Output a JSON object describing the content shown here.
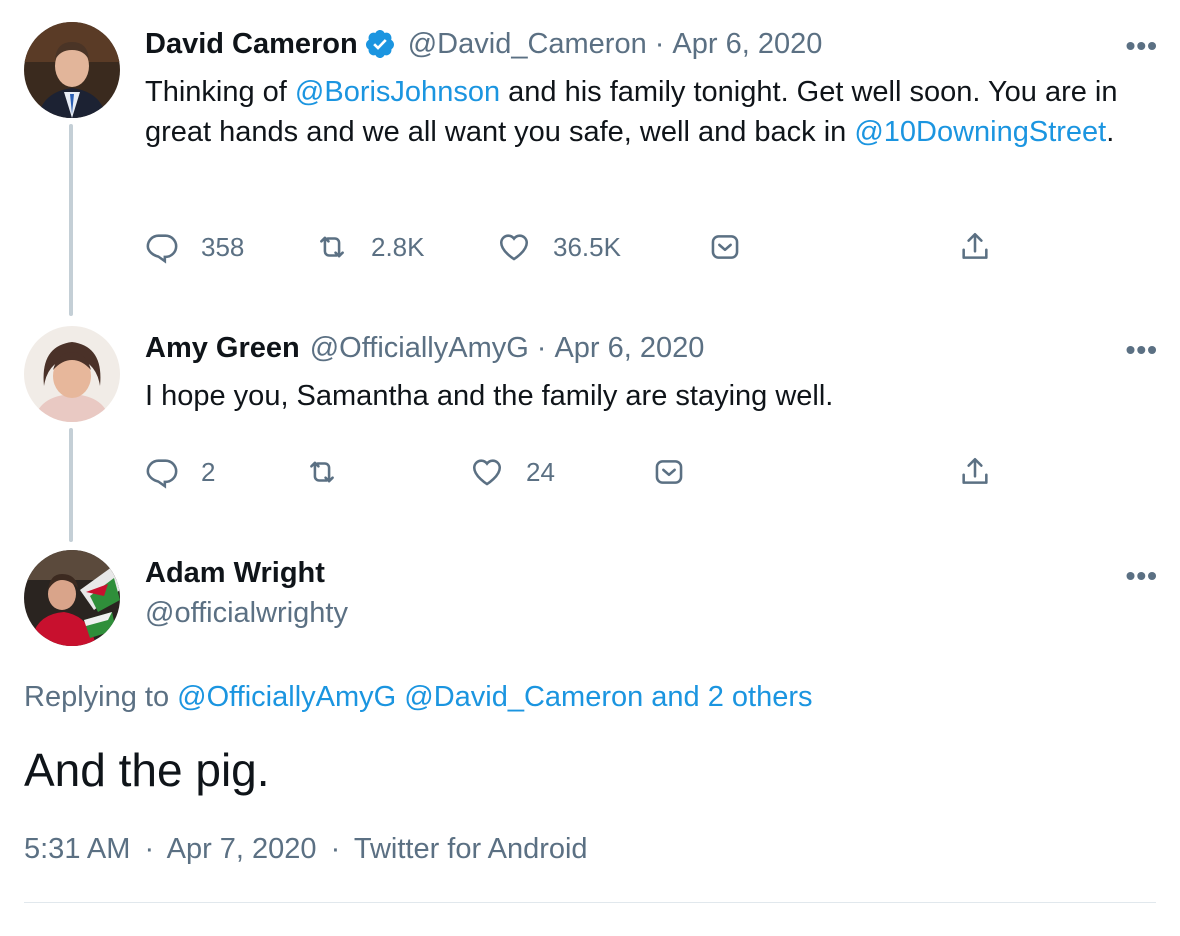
{
  "tweets": [
    {
      "name": "David Cameron",
      "verified": true,
      "handle": "@David_Cameron",
      "date": "Apr 6, 2020",
      "text_parts": [
        {
          "t": "Thinking of ",
          "link": false
        },
        {
          "t": "@BorisJohnson",
          "link": true
        },
        {
          "t": " and his family tonight. Get well soon. You are in great hands and we all want you safe, well and back in ",
          "link": false
        },
        {
          "t": "@10DowningStreet",
          "link": true
        },
        {
          "t": ".",
          "link": false
        }
      ],
      "replies": "358",
      "retweets": "2.8K",
      "likes": "36.5K",
      "icons": [
        "reply-icon",
        "retweet-icon",
        "like-icon",
        "caret-icon",
        "share-icon"
      ]
    },
    {
      "name": "Amy Green",
      "handle": "@OfficiallyAmyG",
      "date": "Apr 6, 2020",
      "text": "I hope you, Samantha and the family are staying well.",
      "replies": "2",
      "retweets": "",
      "likes": "24"
    }
  ],
  "main": {
    "name": "Adam Wright",
    "handle": "@officialwrighty",
    "replying_prefix": "Replying to",
    "replying_to": "@OfficiallyAmyG @David_Cameron and 2 others",
    "text": "And the pig.",
    "time": "5:31 AM",
    "date": "Apr 7, 2020",
    "source": "Twitter for Android"
  },
  "more_label": "•••",
  "sep": "·",
  "colors": {
    "link": "#1b95e0",
    "muted": "#5b7083",
    "line": "#c4cfd6"
  }
}
